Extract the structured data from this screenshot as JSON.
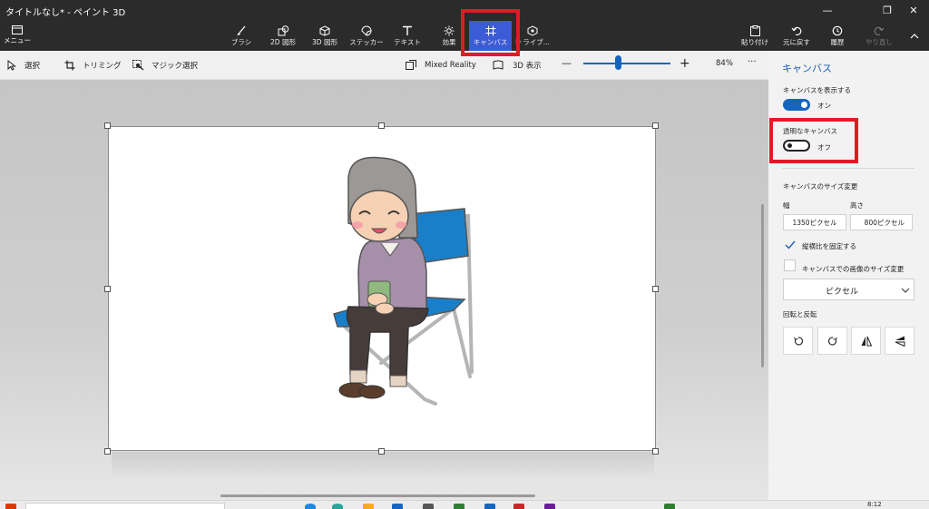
{
  "window": {
    "title": "タイトルなし* - ペイント 3D"
  },
  "ribbon": {
    "menu_label": "メニュー",
    "tools": [
      {
        "label": "ブラシ",
        "icon": "brush-icon"
      },
      {
        "label": "2D 図形",
        "icon": "2d-shapes-icon"
      },
      {
        "label": "3D 図形",
        "icon": "3d-shapes-icon"
      },
      {
        "label": "ステッカー",
        "icon": "stickers-icon"
      },
      {
        "label": "テキスト",
        "icon": "text-icon"
      },
      {
        "label": "効果",
        "icon": "effects-icon"
      },
      {
        "label": "キャンバス",
        "icon": "canvas-icon",
        "active": true
      },
      {
        "label": "D ライブ...",
        "icon": "3d-library-icon"
      }
    ],
    "right": [
      {
        "label": "貼り付け",
        "icon": "paste-icon"
      },
      {
        "label": "元に戻す",
        "icon": "undo-icon"
      },
      {
        "label": "履歴",
        "icon": "history-icon"
      },
      {
        "label": "やり直し",
        "icon": "redo-icon",
        "disabled": true
      }
    ]
  },
  "subbar": {
    "select": "選択",
    "crop": "トリミング",
    "magic_select": "マジック選択",
    "mixed_reality": "Mixed Reality",
    "view_3d": "3D 表示",
    "zoom_out": "—",
    "zoom_in": "+",
    "zoom": "84%",
    "more": "···",
    "zoom_level": 0.4
  },
  "panel": {
    "title": "キャンバス",
    "show_canvas": {
      "label": "キャンバスを表示する",
      "state": "オン",
      "on": true
    },
    "transparent_canvas": {
      "label": "透明なキャンバス",
      "state": "オフ",
      "on": false
    },
    "resize": {
      "title": "キャンバスのサイズ変更",
      "width_label": "幅",
      "height_label": "高さ",
      "width": "1350ピクセル",
      "height": "800ピクセル",
      "lock_aspect": "縦横比を固定する",
      "lock_aspect_checked": true,
      "resize_image": "キャンバスでの画像のサイズ変更",
      "resize_image_checked": false,
      "unit": "ピクセル"
    },
    "rotate": {
      "title": "回転と反転"
    }
  },
  "taskbar": {
    "time": "8:12"
  },
  "colors": {
    "dark_bar": "#2b2b2b",
    "accent": "#3c5bd6",
    "toggle_on": "#1565c0",
    "highlight": "#e01b24",
    "panel_bg": "#f2f2f2"
  }
}
